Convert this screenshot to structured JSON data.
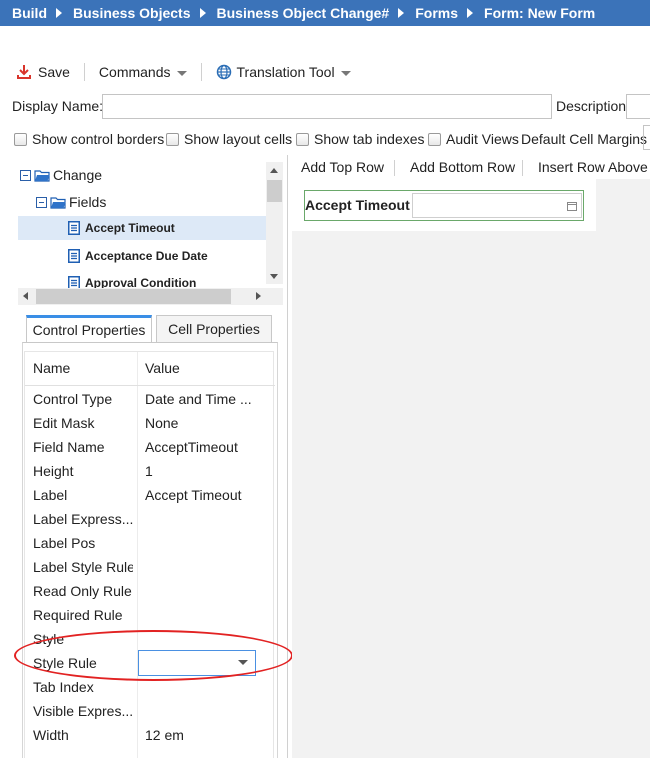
{
  "breadcrumb": [
    "Build",
    "Business Objects",
    "Business Object Change#",
    "Forms",
    "Form: New Form"
  ],
  "toolbar": {
    "save_label": "Save",
    "commands_label": "Commands",
    "translation_label": "Translation Tool"
  },
  "form_header": {
    "display_name_label": "Display Name:",
    "display_name_value": "",
    "description_label": "Description:",
    "description_value": ""
  },
  "options": {
    "show_control_borders": "Show control borders",
    "show_layout_cells": "Show layout cells",
    "show_tab_indexes": "Show tab indexes",
    "audit_views": "Audit Views",
    "default_cell_margins": "Default Cell Margins"
  },
  "tree": {
    "root": "Change",
    "fields_folder": "Fields",
    "items": [
      "Accept Timeout",
      "Acceptance Due Date",
      "Approval Condition"
    ],
    "selected_index": 0
  },
  "property_tabs": [
    "Control Properties",
    "Cell Properties"
  ],
  "properties": {
    "name_header": "Name",
    "value_header": "Value",
    "rows": [
      {
        "name": "Control Type",
        "value": "Date and Time ..."
      },
      {
        "name": "Edit Mask",
        "value": "None"
      },
      {
        "name": "Field Name",
        "value": "AcceptTimeout"
      },
      {
        "name": "Height",
        "value": "1"
      },
      {
        "name": "Label",
        "value": "Accept Timeout"
      },
      {
        "name": "Label Express...",
        "value": ""
      },
      {
        "name": "Label Pos",
        "value": ""
      },
      {
        "name": "Label Style Rule",
        "value": ""
      },
      {
        "name": "Read Only Rule",
        "value": ""
      },
      {
        "name": "Required Rule",
        "value": ""
      },
      {
        "name": "Style",
        "value": ""
      },
      {
        "name": "Style Rule",
        "value": ""
      },
      {
        "name": "Tab Index",
        "value": ""
      },
      {
        "name": "Visible Expres...",
        "value": ""
      },
      {
        "name": "Width",
        "value": "12 em"
      }
    ]
  },
  "canvas_toolbar": {
    "add_top_row": "Add Top Row",
    "add_bottom_row": "Add Bottom Row",
    "insert_row_above": "Insert Row Above"
  },
  "form_control": {
    "label": "Accept Timeout",
    "value": ""
  },
  "colors": {
    "breadcrumb_bg": "#3b73b9",
    "save_icon": "#d9342b",
    "active_tab": "#3a8ee6",
    "highlight": "#e22222",
    "cell_border": "#6aa86a"
  }
}
